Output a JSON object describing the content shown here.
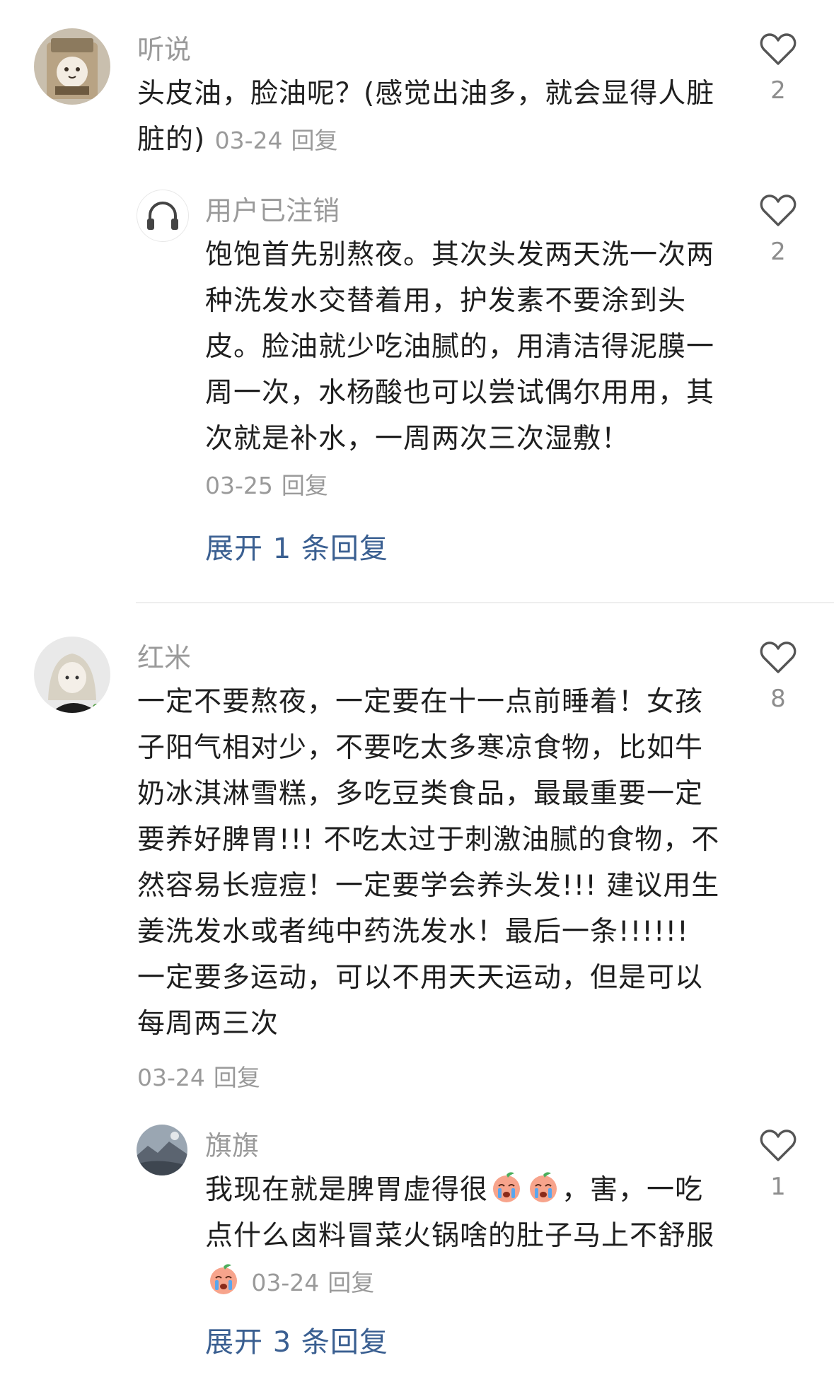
{
  "comments": [
    {
      "author": "听说",
      "text": "头皮油，脸油呢？(感觉出油多，就会显得人脏脏的)",
      "date": "03-24",
      "reply_label": "回复",
      "likes": "2",
      "avatar_icon": "cat-in-bag-avatar",
      "replies": [
        {
          "author": "用户已注销",
          "text": "饱饱首先别熬夜。其次头发两天洗一次两种洗发水交替着用，护发素不要涂到头皮。脸油就少吃油腻的，用清洁得泥膜一周一次，水杨酸也可以尝试偶尔用用，其次就是补水，一周两次三次湿敷！",
          "date": "03-25",
          "reply_label": "回复",
          "likes": "2",
          "avatar_icon": "headphones-avatar"
        }
      ],
      "expand_label": "展开 1 条回复"
    },
    {
      "author": "红米",
      "text": "一定不要熬夜，一定要在十一点前睡着！女孩子阳气相对少，不要吃太多寒凉食物，比如牛奶冰淇淋雪糕，多吃豆类食品，最最重要一定要养好脾胃!!! 不吃太过于刺激油腻的食物，不然容易长痘痘！一定要学会养头发!!! 建议用生姜洗发水或者纯中药洗发水！最后一条!!!!!! 一定要多运动，可以不用天天运动，但是可以每周两三次",
      "date": "03-24",
      "reply_label": "回复",
      "likes": "8",
      "avatar_icon": "anime-character-avatar",
      "replies": [
        {
          "author": "旗旗",
          "text_before_emoji": "我现在就是脾胃虚得很",
          "text_after_emoji": "，害，一吃点什么卤料冒菜火锅啥的肚子马上不舒服",
          "date": "03-24",
          "reply_label": "回复",
          "likes": "1",
          "avatar_icon": "landscape-avatar",
          "emoji_icon": "crying-peach-emoji"
        }
      ],
      "expand_label": "展开 3 条回复"
    }
  ]
}
